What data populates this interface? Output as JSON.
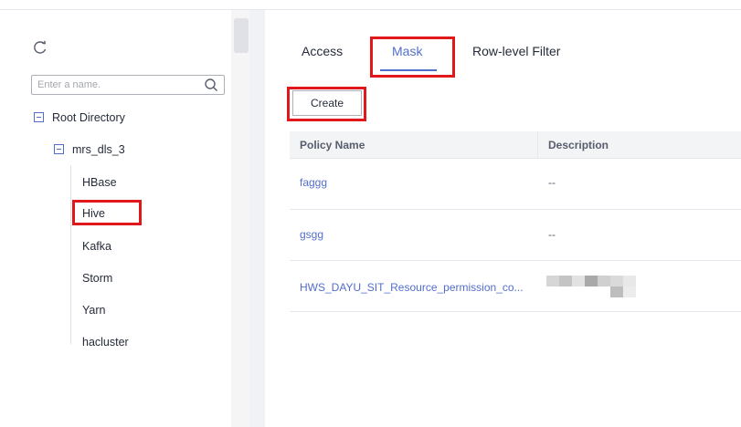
{
  "sidebar": {
    "search_placeholder": "Enter a name.",
    "tree": {
      "root": "Root Directory",
      "cluster": "mrs_dls_3",
      "services": [
        "HBase",
        "Hive",
        "Kafka",
        "Storm",
        "Yarn",
        "hacluster"
      ]
    }
  },
  "tabs": [
    {
      "label": "Access",
      "active": false
    },
    {
      "label": "Mask",
      "active": true
    },
    {
      "label": "Row-level Filter",
      "active": false
    }
  ],
  "toolbar": {
    "create_label": "Create"
  },
  "table": {
    "columns": [
      "Policy Name",
      "Description"
    ],
    "rows": [
      {
        "name": "faggg",
        "description": "--"
      },
      {
        "name": "gsgg",
        "description": "--"
      },
      {
        "name": "HWS_DAYU_SIT_Resource_permission_co...",
        "description": ""
      }
    ]
  },
  "colors": {
    "accent": "#526ecc",
    "highlight_box": "#e0181c",
    "table_header_bg": "#f3f4f6"
  }
}
